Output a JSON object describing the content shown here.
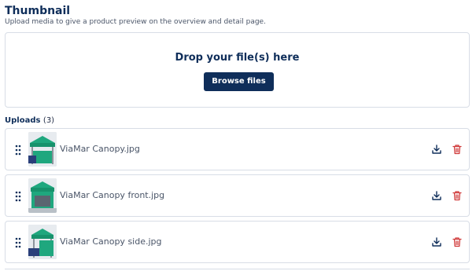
{
  "section": {
    "title": "Thumbnail",
    "subtitle": "Upload media to give a product preview on the overview and detail page."
  },
  "dropzone": {
    "text": "Drop your file(s) here",
    "button_label": "Browse files"
  },
  "uploads": {
    "label": "Uploads",
    "count": "(3)",
    "files": [
      {
        "name": "ViaMar Canopy.jpg"
      },
      {
        "name": "ViaMar Canopy front.jpg"
      },
      {
        "name": "ViaMar Canopy side.jpg"
      }
    ]
  },
  "colors": {
    "primary": "#0f2e5a",
    "delete": "#d03a3a",
    "border": "#d8dde6",
    "canopy_green": "#1fa77e"
  },
  "icons": {
    "drag": "drag-handle-icon",
    "download": "download-icon",
    "delete": "trash-icon"
  }
}
